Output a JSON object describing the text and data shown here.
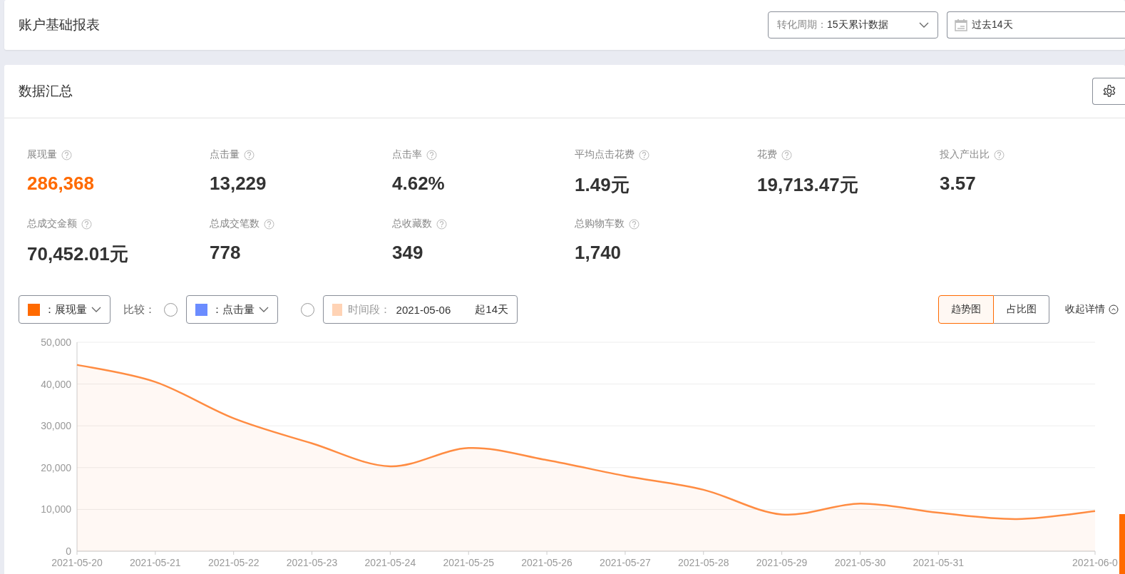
{
  "header": {
    "title": "账户基础报表",
    "period_select": {
      "label": "转化周期：",
      "value": "15天累计数据"
    },
    "date_field": {
      "value": "过去14天"
    }
  },
  "summary": {
    "title": "数据汇总",
    "metrics": [
      {
        "label": "展现量",
        "value": "286,368",
        "selected": true
      },
      {
        "label": "点击量",
        "value": "13,229",
        "selected": false
      },
      {
        "label": "点击率",
        "value": "4.62%",
        "selected": false
      },
      {
        "label": "平均点击花费",
        "value": "1.49元",
        "selected": false
      },
      {
        "label": "花费",
        "value": "19,713.47元",
        "selected": false
      },
      {
        "label": "投入产出比",
        "value": "3.57",
        "selected": false
      },
      {
        "label": "总成交金额",
        "value": "70,452.01元",
        "selected": false
      },
      {
        "label": "总成交笔数",
        "value": "778",
        "selected": false
      },
      {
        "label": "总收藏数",
        "value": "349",
        "selected": false
      },
      {
        "label": "总购物车数",
        "value": "1,740",
        "selected": false
      }
    ],
    "controls": {
      "primary_metric": {
        "value": "：展现量",
        "color": "#ff6a00"
      },
      "compare_label": "比较：",
      "compare_checked": false,
      "compare_metric": {
        "value": "：点击量",
        "color": "#6b8cff"
      },
      "period_checked": false,
      "period": {
        "label": "时间段：",
        "date": "2021-05-06",
        "span": "起14天",
        "color": "#ffd3b5"
      }
    },
    "view_tabs": [
      {
        "label": "趋势图",
        "selected": true
      },
      {
        "label": "占比图",
        "selected": false
      }
    ],
    "collapse_link": "收起详情",
    "chart": {
      "chart_data": {
        "type": "area",
        "categories": [
          "2021-05-20",
          "2021-05-21",
          "2021-05-22",
          "2021-05-23",
          "2021-05-24",
          "2021-05-25",
          "2021-05-26",
          "2021-05-27",
          "2021-05-28",
          "2021-05-29",
          "2021-05-30",
          "2021-05-31",
          null,
          "2021-06-0"
        ],
        "grid": true,
        "series": [
          {
            "color": "#ff8c42",
            "values": [
              44600,
              40500,
              31800,
              25800,
              20300,
              24700,
              21800,
              18000,
              14700,
              8800,
              11400,
              9200,
              7700,
              9600
            ]
          }
        ],
        "ylim": [
          0,
          50000
        ],
        "yticks": [
          {
            "value": 0,
            "label": "0"
          },
          {
            "value": 10000,
            "label": "10,000"
          },
          {
            "value": 20000,
            "label": "20,000"
          },
          {
            "value": 30000,
            "label": "30,000"
          },
          {
            "value": 40000,
            "label": "40,000"
          },
          {
            "value": 50000,
            "label": "50,000"
          }
        ]
      }
    }
  }
}
